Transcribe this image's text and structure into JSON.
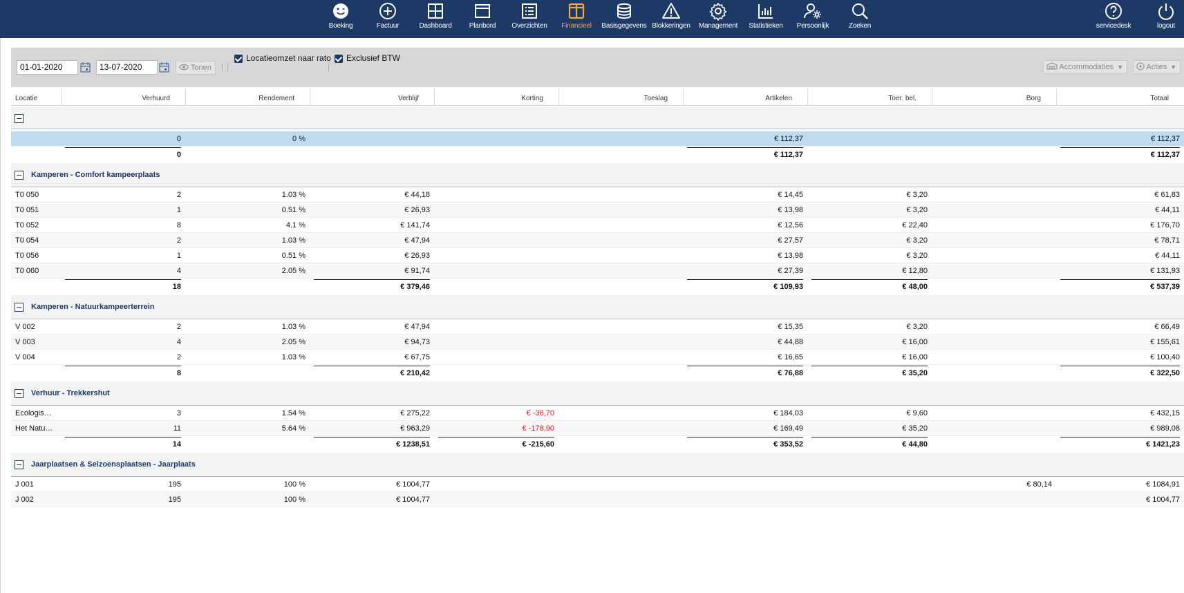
{
  "nav": {
    "items": [
      {
        "label": "Boeking",
        "icon": "smiley-icon"
      },
      {
        "label": "Factuur",
        "icon": "plus-circle-icon"
      },
      {
        "label": "Dashboard",
        "icon": "grid-icon"
      },
      {
        "label": "Planbord",
        "icon": "window-icon"
      },
      {
        "label": "Overzichten",
        "icon": "list-icon"
      },
      {
        "label": "Financieel",
        "icon": "book-icon"
      },
      {
        "label": "Basisgegevens",
        "icon": "database-icon"
      },
      {
        "label": "Blokkeringen",
        "icon": "warning-icon"
      },
      {
        "label": "Management",
        "icon": "gear-icon"
      },
      {
        "label": "Statistieken",
        "icon": "bar-chart-icon"
      },
      {
        "label": "Persoonlijk",
        "icon": "user-gear-icon"
      },
      {
        "label": "Zoeken",
        "icon": "search-icon"
      },
      {
        "label": "servicedesk",
        "icon": "help-icon"
      },
      {
        "label": "logout",
        "icon": "power-icon"
      }
    ],
    "active": "Financieel",
    "colors": {
      "bar": "#1d3a67",
      "active": "#f3a93c"
    }
  },
  "filters": {
    "date_from": "01-01-2020",
    "date_to": "13-07-2020",
    "show_label": "Tonen",
    "checkbox_1": "Locatieomzet naar rato",
    "checkbox_1_checked": true,
    "checkbox_2": "Exclusief BTW",
    "checkbox_2_checked": true,
    "accommodations_label": "Accommodaties",
    "actions_label": "Acties"
  },
  "table": {
    "columns": [
      "Locatie",
      "Verhuurd",
      "Rendement",
      "Verblijf",
      "Korting",
      "Toeslag",
      "Artikelen",
      "Toer. bel.",
      "Borg",
      "Totaal"
    ],
    "ungrouped": {
      "rows": [
        {
          "Locatie": "",
          "Verhuurd": "0",
          "Rendement": "0 %",
          "Verblijf": "",
          "Korting": "",
          "Toeslag": "",
          "Artikelen": "€ 112,37",
          "Toer. bel.": "",
          "Borg": "",
          "Totaal": "€ 112,37"
        }
      ],
      "totals": {
        "Verhuurd": "0",
        "Artikelen": "€ 112,37",
        "Totaal": "€ 112,37"
      }
    },
    "groups": [
      {
        "title": "Kamperen - Comfort kampeerplaats",
        "rows": [
          {
            "Locatie": "T0 050",
            "Verhuurd": "2",
            "Rendement": "1.03 %",
            "Verblijf": "€ 44,18",
            "Korting": "",
            "Toeslag": "",
            "Artikelen": "€ 14,45",
            "Toer. bel.": "€ 3,20",
            "Borg": "",
            "Totaal": "€ 61,83"
          },
          {
            "Locatie": "T0 051",
            "Verhuurd": "1",
            "Rendement": "0.51 %",
            "Verblijf": "€ 26,93",
            "Korting": "",
            "Toeslag": "",
            "Artikelen": "€ 13,98",
            "Toer. bel.": "€ 3,20",
            "Borg": "",
            "Totaal": "€ 44,11"
          },
          {
            "Locatie": "T0 052",
            "Verhuurd": "8",
            "Rendement": "4.1 %",
            "Verblijf": "€ 141,74",
            "Korting": "",
            "Toeslag": "",
            "Artikelen": "€ 12,56",
            "Toer. bel.": "€ 22,40",
            "Borg": "",
            "Totaal": "€ 176,70"
          },
          {
            "Locatie": "T0 054",
            "Verhuurd": "2",
            "Rendement": "1.03 %",
            "Verblijf": "€ 47,94",
            "Korting": "",
            "Toeslag": "",
            "Artikelen": "€ 27,57",
            "Toer. bel.": "€ 3,20",
            "Borg": "",
            "Totaal": "€ 78,71"
          },
          {
            "Locatie": "T0 056",
            "Verhuurd": "1",
            "Rendement": "0.51 %",
            "Verblijf": "€ 26,93",
            "Korting": "",
            "Toeslag": "",
            "Artikelen": "€ 13,98",
            "Toer. bel.": "€ 3,20",
            "Borg": "",
            "Totaal": "€ 44,11"
          },
          {
            "Locatie": "T0 060",
            "Verhuurd": "4",
            "Rendement": "2.05 %",
            "Verblijf": "€ 91,74",
            "Korting": "",
            "Toeslag": "",
            "Artikelen": "€ 27,39",
            "Toer. bel.": "€ 12,80",
            "Borg": "",
            "Totaal": "€ 131,93"
          }
        ],
        "totals": {
          "Verhuurd": "18",
          "Verblijf": "€ 379,46",
          "Artikelen": "€ 109,93",
          "Toer. bel.": "€ 48,00",
          "Totaal": "€ 537,39"
        }
      },
      {
        "title": "Kamperen - Natuurkampeerterrein",
        "rows": [
          {
            "Locatie": "V 002",
            "Verhuurd": "2",
            "Rendement": "1.03 %",
            "Verblijf": "€ 47,94",
            "Korting": "",
            "Toeslag": "",
            "Artikelen": "€ 15,35",
            "Toer. bel.": "€ 3,20",
            "Borg": "",
            "Totaal": "€ 66,49"
          },
          {
            "Locatie": "V 003",
            "Verhuurd": "4",
            "Rendement": "2.05 %",
            "Verblijf": "€ 94,73",
            "Korting": "",
            "Toeslag": "",
            "Artikelen": "€ 44,88",
            "Toer. bel.": "€ 16,00",
            "Borg": "",
            "Totaal": "€ 155,61"
          },
          {
            "Locatie": "V 004",
            "Verhuurd": "2",
            "Rendement": "1.03 %",
            "Verblijf": "€ 67,75",
            "Korting": "",
            "Toeslag": "",
            "Artikelen": "€ 16,65",
            "Toer. bel.": "€ 16,00",
            "Borg": "",
            "Totaal": "€ 100,40"
          }
        ],
        "totals": {
          "Verhuurd": "8",
          "Verblijf": "€ 210,42",
          "Artikelen": "€ 76,88",
          "Toer. bel.": "€ 35,20",
          "Totaal": "€ 322,50"
        }
      },
      {
        "title": "Verhuur - Trekkershut",
        "rows": [
          {
            "Locatie": "Ecologis…",
            "Verhuurd": "3",
            "Rendement": "1.54 %",
            "Verblijf": "€ 275,22",
            "Korting": "€ -36,70",
            "Toeslag": "",
            "Artikelen": "€ 184,03",
            "Toer. bel.": "€ 9,60",
            "Borg": "",
            "Totaal": "€ 432,15"
          },
          {
            "Locatie": "Het Natu…",
            "Verhuurd": "11",
            "Rendement": "5.64 %",
            "Verblijf": "€ 963,29",
            "Korting": "€ -178,90",
            "Toeslag": "",
            "Artikelen": "€ 169,49",
            "Toer. bel.": "€ 35,20",
            "Borg": "",
            "Totaal": "€ 989,08"
          }
        ],
        "totals": {
          "Verhuurd": "14",
          "Verblijf": "€ 1238,51",
          "Korting": "€ -215,60",
          "Artikelen": "€ 353,52",
          "Toer. bel.": "€ 44,80",
          "Totaal": "€ 1421,23"
        }
      },
      {
        "title": "Jaarplaatsen & Seizoensplaatsen - Jaarplaats",
        "rows": [
          {
            "Locatie": "J 001",
            "Verhuurd": "195",
            "Rendement": "100 %",
            "Verblijf": "€ 1004,77",
            "Korting": "",
            "Toeslag": "",
            "Artikelen": "",
            "Toer. bel.": "",
            "Borg": "€ 80,14",
            "Totaal": "€ 1084,91"
          },
          {
            "Locatie": "J 002",
            "Verhuurd": "195",
            "Rendement": "100 %",
            "Verblijf": "€ 1004,77",
            "Korting": "",
            "Toeslag": "",
            "Artikelen": "",
            "Toer. bel.": "",
            "Borg": "",
            "Totaal": "€ 1004,77"
          }
        ],
        "totals": null
      }
    ],
    "colors": {
      "selected_row": "#bfdbf2",
      "negative": "#e0141e",
      "group_title": "#1d3a67"
    }
  }
}
